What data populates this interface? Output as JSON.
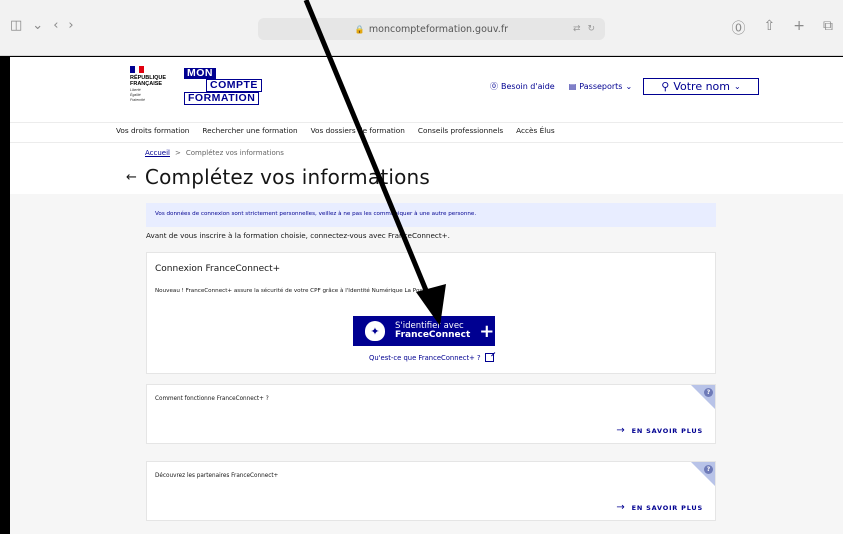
{
  "browser": {
    "url": "moncompteformation.gouv.fr",
    "nav_left": [
      "◫",
      "⌄",
      "‹",
      "›"
    ],
    "nav_right": [
      "⓪",
      "⇧",
      "+",
      "⧉"
    ]
  },
  "header": {
    "marianne": {
      "line1": "RÉPUBLIQUE",
      "line2": "FRANÇAISE",
      "motto1": "Liberté",
      "motto2": "Égalité",
      "motto3": "Fraternité"
    },
    "logo": {
      "l1": "MON",
      "l2": "COMPTE",
      "l3": "FORMATION"
    },
    "help_label": "Besoin d'aide",
    "passports_label": "Passeports",
    "user_label": "Votre nom"
  },
  "nav": {
    "items": [
      "Vos droits formation",
      "Rechercher une formation",
      "Vos dossiers de formation",
      "Conseils professionnels",
      "Accès Élus"
    ]
  },
  "breadcrumb": {
    "home": "Accueil",
    "sep": ">",
    "current": "Complétez vos informations"
  },
  "page_title": "Complétez vos informations",
  "notice": "Vos données de connexion sont strictement personnelles, veillez à ne pas les communiquer à une autre personne.",
  "intro": "Avant de vous inscrire à la formation choisie, connectez-vous avec FranceConnect+.",
  "fc_card": {
    "title": "Connexion FranceConnect+",
    "description": "Nouveau ! FranceConnect+ assure la sécurité de votre CPF grâce à l'Identité Numérique La Poste.",
    "button_line1": "S'identifier avec",
    "button_line2": "FranceConnect",
    "button_plus": "+",
    "link": "Qu'est-ce que FranceConnect+ ?"
  },
  "info_cards": [
    {
      "question": "Comment fonctionne FranceConnect+ ?",
      "more": "EN SAVOIR PLUS"
    },
    {
      "question": "Découvrez les partenaires FranceConnect+",
      "more": "EN SAVOIR PLUS"
    }
  ],
  "colors": {
    "accent": "#000091",
    "notice_bg": "#e8edff",
    "page_bg": "#f6f6f6"
  }
}
